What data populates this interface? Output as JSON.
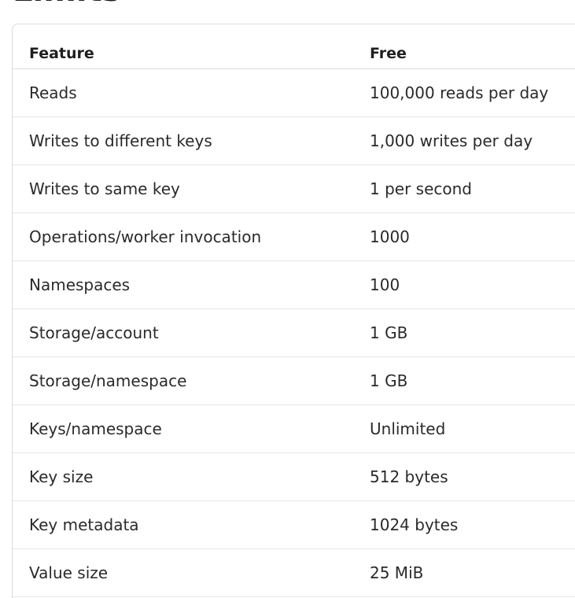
{
  "page": {
    "heading": "Limits"
  },
  "table": {
    "columns": [
      "Feature",
      "Free"
    ],
    "rows": [
      [
        "Reads",
        "100,000 reads per day"
      ],
      [
        "Writes to different keys",
        "1,000 writes per day"
      ],
      [
        "Writes to same key",
        "1 per second"
      ],
      [
        "Operations/worker invocation",
        "1000"
      ],
      [
        "Namespaces",
        "100"
      ],
      [
        "Storage/account",
        "1 GB"
      ],
      [
        "Storage/namespace",
        "1 GB"
      ],
      [
        "Keys/namespace",
        "Unlimited"
      ],
      [
        "Key size",
        "512 bytes"
      ],
      [
        "Key metadata",
        "1024 bytes"
      ],
      [
        "Value size",
        "25 MiB"
      ]
    ]
  }
}
